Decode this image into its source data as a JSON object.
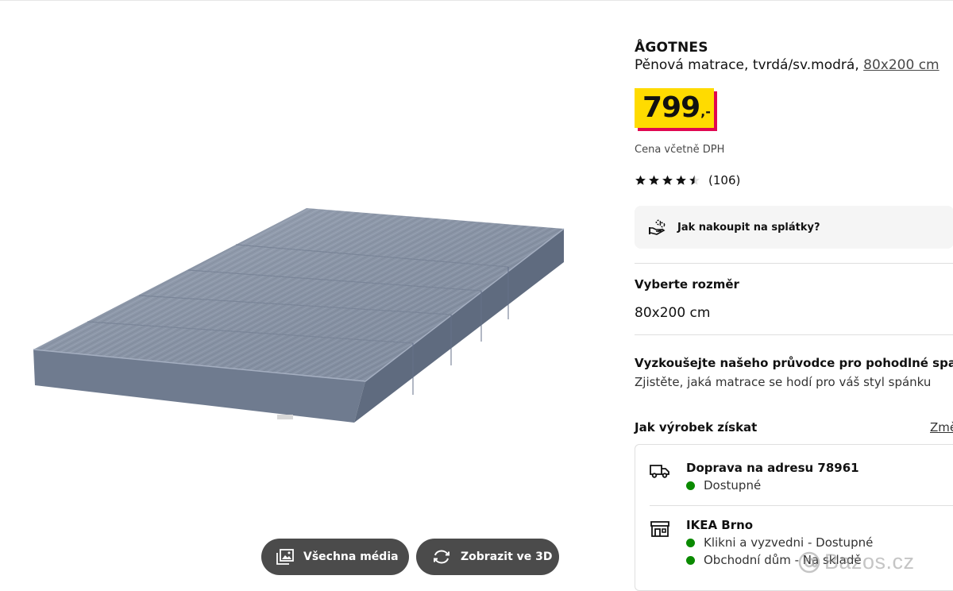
{
  "product": {
    "name": "ÅGOTNES",
    "description": "Pěnová matrace, tvrdá/sv.modrá,",
    "size_link": "80x200 cm",
    "price_value": "799",
    "price_suffix": ",-",
    "vat_note": "Cena včetně DPH",
    "rating": {
      "stars": 4.5,
      "max": 5,
      "reviews": "(106)"
    }
  },
  "installments": {
    "label": "Jak nakoupit na splátky?",
    "icon": "hand-coins-icon"
  },
  "size_section": {
    "title": "Vyberte rozměr",
    "value": "80x200 cm"
  },
  "guide": {
    "title": "Vyzkoušejte našeho průvodce pro pohodlné spaní",
    "subtitle": "Zjistěte, jaká matrace se hodí pro váš styl spánku"
  },
  "availability": {
    "title": "Jak výrobek získat",
    "change_link": "Změ",
    "delivery": {
      "icon": "truck-icon",
      "title": "Doprava na adresu 78961",
      "status": "Dostupné"
    },
    "store": {
      "icon": "store-icon",
      "title": "IKEA Brno",
      "click_collect": "Klikni a vyzvedni - Dostupné",
      "in_store": "Obchodní dům - Na skladě"
    },
    "status_color": "#0a8a00"
  },
  "media_buttons": {
    "all_media": "Všechna média",
    "view_3d": "Zobrazit ve 3D"
  },
  "watermark": {
    "text": "Bazos.cz"
  },
  "colors": {
    "price_bg": "#ffdb00",
    "price_shadow": "#e00751",
    "button_bg": "#4b4b4b"
  }
}
